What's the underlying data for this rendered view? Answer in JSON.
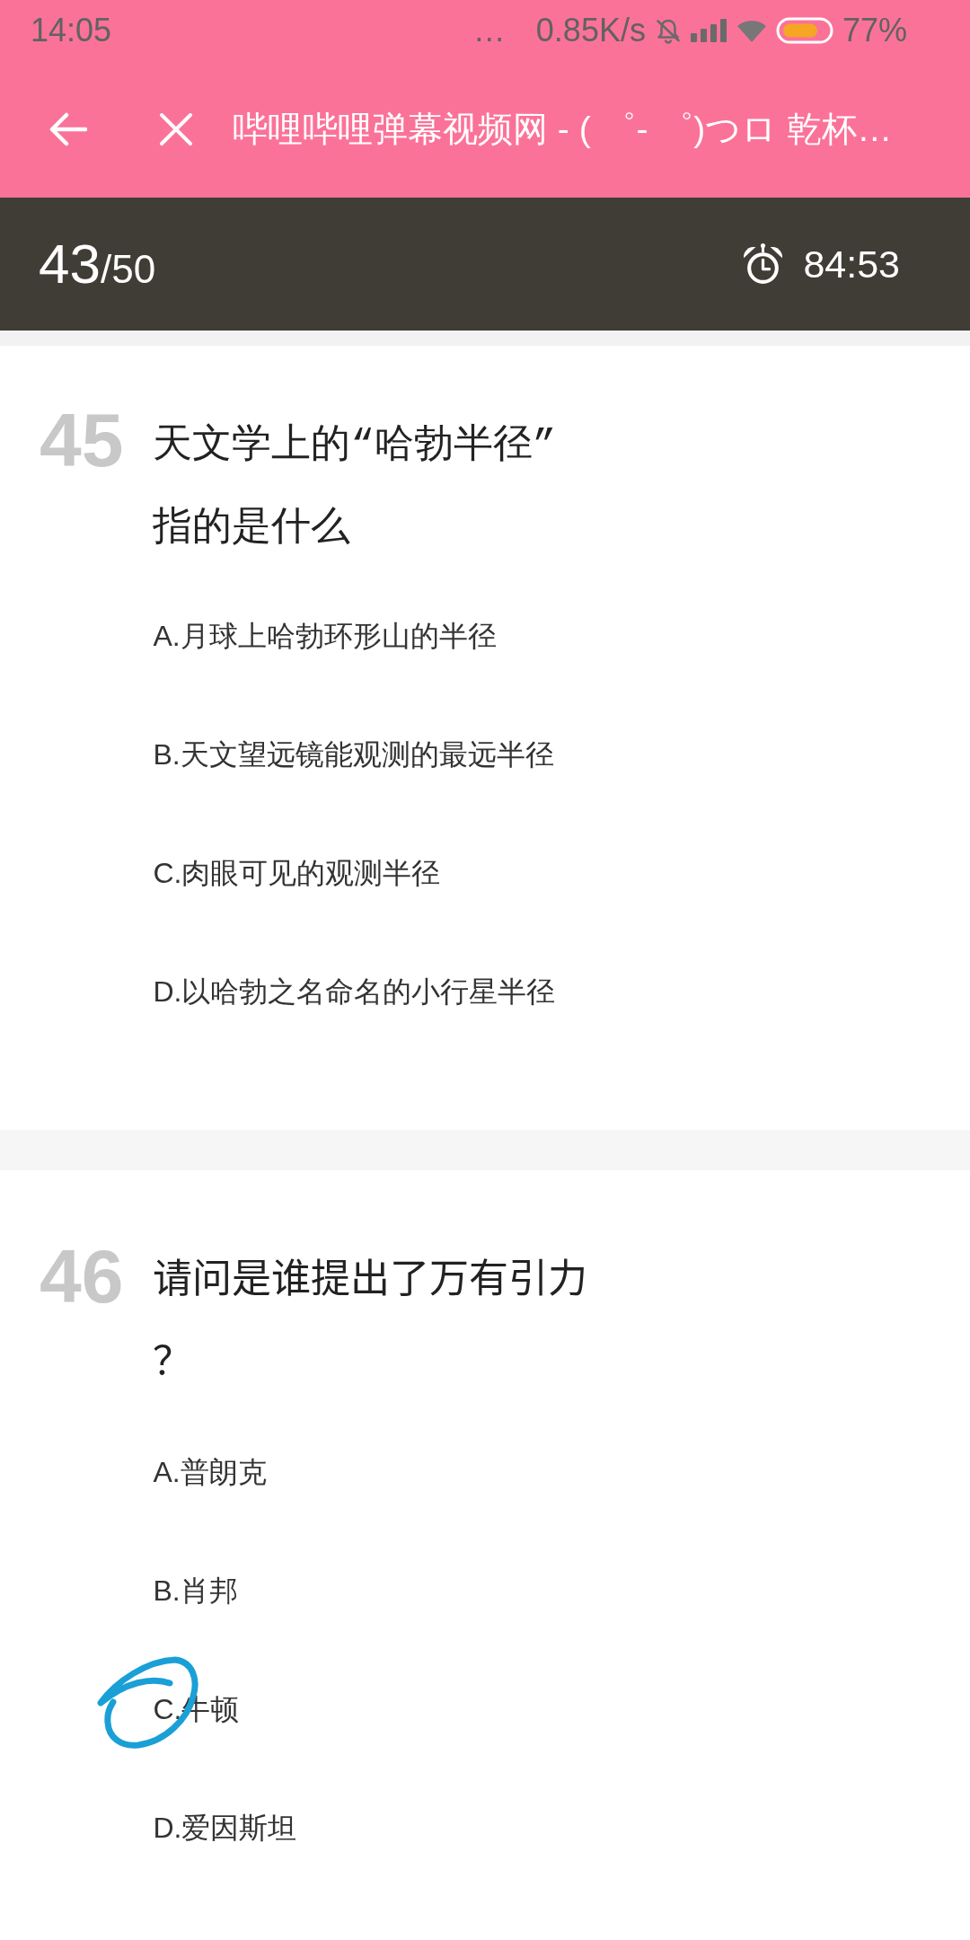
{
  "status_bar": {
    "time": "14:05",
    "overflow": "…",
    "net_speed": "0.85K/s",
    "battery": "77%"
  },
  "title_bar": {
    "title": "哔哩哔哩弹幕视频网 - ( ゜- ゜)つロ 乾杯…"
  },
  "quiz_bar": {
    "current": "43",
    "total": "/50",
    "timer": "84:53"
  },
  "questions": [
    {
      "number": "45",
      "text": "天文学上的“哈勃半径”指的是什么",
      "options": [
        {
          "text": "A.月球上哈勃环形山的半径",
          "circled": false
        },
        {
          "text": "B.天文望远镜能观测的最远半径",
          "circled": false
        },
        {
          "text": "C.肉眼可见的观测半径",
          "circled": false
        },
        {
          "text": "D.以哈勃之名命名的小行星半径",
          "circled": false
        }
      ]
    },
    {
      "number": "46",
      "text": "请问是谁提出了万有引力？",
      "options": [
        {
          "text": "A.普朗克",
          "circled": false
        },
        {
          "text": "B.肖邦",
          "circled": false
        },
        {
          "text": "C.牛顿",
          "circled": true
        },
        {
          "text": "D.爱因斯坦",
          "circled": false
        }
      ]
    }
  ]
}
